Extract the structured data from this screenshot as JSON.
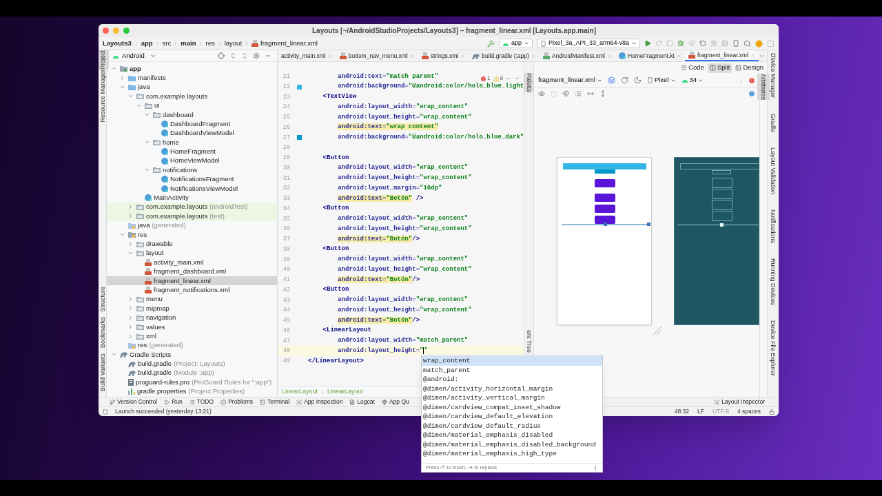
{
  "window": {
    "title": "Layouts [~/AndroidStudioProjects/Layouts3] – fragment_linear.xml [Layouts.app.main]"
  },
  "breadcrumb": [
    {
      "label": "Layouts3",
      "bold": true,
      "kind": "folder"
    },
    {
      "label": "app",
      "bold": true,
      "kind": "folder"
    },
    {
      "label": "src",
      "bold": false,
      "kind": "folder"
    },
    {
      "label": "main",
      "bold": true,
      "kind": "folder"
    },
    {
      "label": "res",
      "bold": false,
      "kind": "folder"
    },
    {
      "label": "layout",
      "bold": false,
      "kind": "folder"
    },
    {
      "label": "fragment_linear.xml",
      "bold": false,
      "kind": "xml"
    }
  ],
  "run_toolbar": {
    "module": "app",
    "device": "Pixel_3a_API_33_arm64-v8a"
  },
  "left_stripe": {
    "top": [
      {
        "label": "Project",
        "selected": true
      },
      {
        "label": "Resource Manager",
        "selected": false
      }
    ],
    "bottom": [
      {
        "label": "Structure",
        "selected": false
      },
      {
        "label": "Bookmarks",
        "selected": false
      },
      {
        "label": "Build Variants",
        "selected": false
      }
    ]
  },
  "project_panel": {
    "view": "Android",
    "tree": [
      {
        "name": "app",
        "kind": "module",
        "expanded": true,
        "selected": false,
        "children": [
          {
            "name": "manifests",
            "kind": "folder",
            "expanded": false,
            "selected": false
          },
          {
            "name": "java",
            "kind": "folder",
            "expanded": true,
            "selected": false,
            "children": [
              {
                "name": "com.example.layouts",
                "kind": "package",
                "expanded": true,
                "selected": false,
                "children": [
                  {
                    "name": "ui",
                    "kind": "package",
                    "expanded": true,
                    "selected": false,
                    "children": [
                      {
                        "name": "dashboard",
                        "kind": "package",
                        "expanded": true,
                        "selected": false,
                        "children": [
                          {
                            "name": "DashboardFragment",
                            "kind": "class",
                            "selected": false
                          },
                          {
                            "name": "DashboardViewModel",
                            "kind": "class",
                            "selected": false
                          }
                        ]
                      },
                      {
                        "name": "home",
                        "kind": "package",
                        "expanded": true,
                        "selected": false,
                        "children": [
                          {
                            "name": "HomeFragment",
                            "kind": "class",
                            "selected": false
                          },
                          {
                            "name": "HomeViewModel",
                            "kind": "class",
                            "selected": false
                          }
                        ]
                      },
                      {
                        "name": "notifications",
                        "kind": "package",
                        "expanded": true,
                        "selected": false,
                        "children": [
                          {
                            "name": "NotificationsFragment",
                            "kind": "class",
                            "selected": false
                          },
                          {
                            "name": "NotificationsViewModel",
                            "kind": "class",
                            "selected": false
                          }
                        ]
                      }
                    ]
                  },
                  {
                    "name": "MainActivity",
                    "kind": "class",
                    "selected": false
                  }
                ]
              },
              {
                "name": "com.example.layouts",
                "note": "(androidTest)",
                "kind": "test-package",
                "expanded": false,
                "selected": false
              },
              {
                "name": "com.example.layouts",
                "note": "(test)",
                "kind": "test-package",
                "expanded": false,
                "selected": false
              }
            ]
          },
          {
            "name": "java",
            "note": "(generated)",
            "kind": "generated",
            "selected": false
          },
          {
            "name": "res",
            "kind": "res",
            "expanded": true,
            "selected": false,
            "children": [
              {
                "name": "drawable",
                "kind": "package",
                "expanded": false,
                "selected": false
              },
              {
                "name": "layout",
                "kind": "package",
                "expanded": true,
                "selected": false,
                "children": [
                  {
                    "name": "activity_main.xml",
                    "kind": "xml",
                    "selected": false
                  },
                  {
                    "name": "fragment_dashboard.xml",
                    "kind": "xml",
                    "selected": false
                  },
                  {
                    "name": "fragment_linear.xml",
                    "kind": "xml",
                    "selected": true
                  },
                  {
                    "name": "fragment_notifications.xml",
                    "kind": "xml",
                    "selected": false
                  }
                ]
              },
              {
                "name": "menu",
                "kind": "package",
                "expanded": false,
                "selected": false
              },
              {
                "name": "mipmap",
                "kind": "package",
                "expanded": false,
                "selected": false
              },
              {
                "name": "navigation",
                "kind": "package",
                "expanded": false,
                "selected": false
              },
              {
                "name": "values",
                "kind": "package",
                "expanded": false,
                "selected": false
              },
              {
                "name": "xml",
                "kind": "package",
                "expanded": false,
                "selected": false
              }
            ]
          },
          {
            "name": "res",
            "note": "(generated)",
            "kind": "generated",
            "selected": false
          }
        ]
      },
      {
        "name": "Gradle Scripts",
        "kind": "gradle",
        "expanded": true,
        "selected": false,
        "children": [
          {
            "name": "build.gradle",
            "note": "(Project: Layouts)",
            "kind": "gradle",
            "selected": false
          },
          {
            "name": "build.gradle",
            "note": "(Module :app)",
            "kind": "gradle",
            "selected": false
          },
          {
            "name": "proguard-rules.pro",
            "note": "(ProGuard Rules for \":app\")",
            "kind": "file",
            "selected": false
          },
          {
            "name": "gradle.properties",
            "note": "(Project Properties)",
            "kind": "properties",
            "selected": false
          }
        ]
      }
    ]
  },
  "editor_tabs": [
    {
      "label": "activity_main.xml",
      "kind": "plain",
      "selected": false
    },
    {
      "label": "bottom_nav_menu.xml",
      "kind": "xml",
      "selected": false
    },
    {
      "label": "strings.xml",
      "kind": "xml",
      "selected": false
    },
    {
      "label": "build.gradle (:app)",
      "kind": "gradle",
      "selected": false
    },
    {
      "label": "AndroidManifest.xml",
      "kind": "manifest",
      "selected": false
    },
    {
      "label": "HomeFragment.kt",
      "kind": "class",
      "selected": false
    },
    {
      "label": "fragment_linear.xml",
      "kind": "xml",
      "selected": true
    }
  ],
  "code": {
    "errors": "1",
    "warnings": "9",
    "lines": [
      {
        "number": "21",
        "kind": "attribute",
        "warning": false,
        "current": false,
        "parts": [
          {
            "kind": "attr",
            "text": "android:text"
          },
          {
            "kind": "punct",
            "text": "="
          },
          {
            "kind": "value",
            "text": "\"match parent\""
          }
        ]
      },
      {
        "number": "22",
        "kind": "attribute",
        "warning": false,
        "current": false,
        "color": "#33b5e5",
        "parts": [
          {
            "kind": "attr",
            "text": "android:background"
          },
          {
            "kind": "punct",
            "text": "="
          },
          {
            "kind": "value",
            "text": "\"@android:color/holo_blue_light"
          }
        ]
      },
      {
        "number": "23",
        "kind": "element",
        "warning": false,
        "current": false,
        "parts": [
          {
            "kind": "tag",
            "text": "<TextView"
          }
        ]
      },
      {
        "number": "24",
        "kind": "attribute",
        "warning": false,
        "current": false,
        "parts": [
          {
            "kind": "attr",
            "text": "android:layout_width"
          },
          {
            "kind": "punct",
            "text": "="
          },
          {
            "kind": "value",
            "text": "\"wrap_content\""
          }
        ]
      },
      {
        "number": "25",
        "kind": "attribute",
        "warning": false,
        "current": false,
        "parts": [
          {
            "kind": "attr",
            "text": "android:layout_height"
          },
          {
            "kind": "punct",
            "text": "="
          },
          {
            "kind": "value",
            "text": "\"wrap_content\""
          }
        ]
      },
      {
        "number": "26",
        "kind": "attribute",
        "warning": true,
        "current": false,
        "parts": [
          {
            "kind": "attr",
            "text": "android:text"
          },
          {
            "kind": "punct",
            "text": "="
          },
          {
            "kind": "value",
            "text": "\"wrap content\""
          }
        ]
      },
      {
        "number": "27",
        "kind": "attribute",
        "warning": false,
        "current": false,
        "color": "#0099cc",
        "parts": [
          {
            "kind": "attr",
            "text": "android:background"
          },
          {
            "kind": "punct",
            "text": "="
          },
          {
            "kind": "value",
            "text": "\"@android:color/holo_blue_dark\""
          }
        ]
      },
      {
        "number": "28",
        "kind": "blank"
      },
      {
        "number": "29",
        "kind": "element",
        "warning": false,
        "current": false,
        "parts": [
          {
            "kind": "tag",
            "text": "<Button"
          }
        ]
      },
      {
        "number": "30",
        "kind": "attribute",
        "warning": false,
        "current": false,
        "parts": [
          {
            "kind": "attr",
            "text": "android:layout_width"
          },
          {
            "kind": "punct",
            "text": "="
          },
          {
            "kind": "value",
            "text": "\"wrap_content\""
          }
        ]
      },
      {
        "number": "31",
        "kind": "attribute",
        "warning": false,
        "current": false,
        "parts": [
          {
            "kind": "attr",
            "text": "android:layout_height"
          },
          {
            "kind": "punct",
            "text": "="
          },
          {
            "kind": "value",
            "text": "\"wrap_content\""
          }
        ]
      },
      {
        "number": "32",
        "kind": "attribute",
        "warning": false,
        "current": false,
        "parts": [
          {
            "kind": "attr",
            "text": "android:layout_margin"
          },
          {
            "kind": "punct",
            "text": "="
          },
          {
            "kind": "value",
            "text": "\"16dp\""
          }
        ]
      },
      {
        "number": "33",
        "kind": "attribute",
        "warning": true,
        "current": false,
        "parts": [
          {
            "kind": "attr",
            "text": "android:text"
          },
          {
            "kind": "punct",
            "text": "="
          },
          {
            "kind": "value",
            "text": "\"Botón\""
          },
          {
            "kind": "tag",
            "text": " />"
          }
        ]
      },
      {
        "number": "34",
        "kind": "element",
        "warning": false,
        "current": false,
        "parts": [
          {
            "kind": "tag",
            "text": "<Button"
          }
        ]
      },
      {
        "number": "35",
        "kind": "attribute",
        "warning": false,
        "current": false,
        "parts": [
          {
            "kind": "attr",
            "text": "android:layout_width"
          },
          {
            "kind": "punct",
            "text": "="
          },
          {
            "kind": "value",
            "text": "\"wrap_content\""
          }
        ]
      },
      {
        "number": "36",
        "kind": "attribute",
        "warning": false,
        "current": false,
        "parts": [
          {
            "kind": "attr",
            "text": "android:layout_height"
          },
          {
            "kind": "punct",
            "text": "="
          },
          {
            "kind": "value",
            "text": "\"wrap_content\""
          }
        ]
      },
      {
        "number": "37",
        "kind": "attribute",
        "warning": true,
        "current": false,
        "parts": [
          {
            "kind": "attr",
            "text": "android:text"
          },
          {
            "kind": "punct",
            "text": "="
          },
          {
            "kind": "value",
            "text": "\"Botón\""
          },
          {
            "kind": "tag",
            "text": "/>"
          }
        ]
      },
      {
        "number": "38",
        "kind": "element",
        "warning": false,
        "current": false,
        "parts": [
          {
            "kind": "tag",
            "text": "<Button"
          }
        ]
      },
      {
        "number": "39",
        "kind": "attribute",
        "warning": false,
        "current": false,
        "parts": [
          {
            "kind": "attr",
            "text": "android:layout_width"
          },
          {
            "kind": "punct",
            "text": "="
          },
          {
            "kind": "value",
            "text": "\"wrap_content\""
          }
        ]
      },
      {
        "number": "40",
        "kind": "attribute",
        "warning": false,
        "current": false,
        "parts": [
          {
            "kind": "attr",
            "text": "android:layout_height"
          },
          {
            "kind": "punct",
            "text": "="
          },
          {
            "kind": "value",
            "text": "\"wrap_content\""
          }
        ]
      },
      {
        "number": "41",
        "kind": "attribute",
        "warning": true,
        "current": false,
        "parts": [
          {
            "kind": "attr",
            "text": "android:text"
          },
          {
            "kind": "punct",
            "text": "="
          },
          {
            "kind": "value",
            "text": "\"Botón\""
          },
          {
            "kind": "tag",
            "text": "/>"
          }
        ]
      },
      {
        "number": "42",
        "kind": "element",
        "warning": false,
        "current": false,
        "parts": [
          {
            "kind": "tag",
            "text": "<Button"
          }
        ]
      },
      {
        "number": "43",
        "kind": "attribute",
        "warning": false,
        "current": false,
        "parts": [
          {
            "kind": "attr",
            "text": "android:layout_width"
          },
          {
            "kind": "punct",
            "text": "="
          },
          {
            "kind": "value",
            "text": "\"wrap_content\""
          }
        ]
      },
      {
        "number": "44",
        "kind": "attribute",
        "warning": false,
        "current": false,
        "parts": [
          {
            "kind": "attr",
            "text": "android:layout_height"
          },
          {
            "kind": "punct",
            "text": "="
          },
          {
            "kind": "value",
            "text": "\"wrap_content\""
          }
        ]
      },
      {
        "number": "45",
        "kind": "attribute",
        "warning": true,
        "current": false,
        "parts": [
          {
            "kind": "attr",
            "text": "android:text"
          },
          {
            "kind": "punct",
            "text": "="
          },
          {
            "kind": "value",
            "text": "\"Botón\""
          },
          {
            "kind": "tag",
            "text": "/>"
          }
        ]
      },
      {
        "number": "46",
        "kind": "element",
        "warning": false,
        "current": false,
        "parts": [
          {
            "kind": "tag",
            "text": "<LinearLayout"
          }
        ]
      },
      {
        "number": "47",
        "kind": "attribute",
        "warning": false,
        "current": false,
        "parts": [
          {
            "kind": "attr",
            "text": "android:layout_width"
          },
          {
            "kind": "punct",
            "text": "="
          },
          {
            "kind": "value",
            "text": "\"match_parent\""
          }
        ]
      },
      {
        "number": "48",
        "kind": "attribute",
        "warning": false,
        "current": true,
        "parts": [
          {
            "kind": "attr",
            "text": "android:layout_height"
          },
          {
            "kind": "punct",
            "text": "="
          },
          {
            "kind": "value",
            "text": "\""
          },
          {
            "kind": "caret"
          },
          {
            "kind": "value",
            "text": "\""
          }
        ]
      },
      {
        "number": "49",
        "kind": "root",
        "warning": false,
        "current": false,
        "parts": [
          {
            "kind": "tag",
            "text": "</LinearLayout>"
          }
        ]
      }
    ]
  },
  "code_breadcrumb": [
    "LinearLayout",
    "LinearLayout"
  ],
  "editor_stripe": {
    "top": {
      "label": "Palette",
      "selected": true
    },
    "bottom": {
      "label": "ent Tree",
      "selected": false
    }
  },
  "design": {
    "view_modes": [
      {
        "label": "Code",
        "kind": "code",
        "selected": false
      },
      {
        "label": "Split",
        "kind": "split",
        "selected": true
      },
      {
        "label": "Design",
        "kind": "design",
        "selected": false
      }
    ],
    "file": "fragment_linear.xml",
    "device": "Pixel",
    "api": "34"
  },
  "attributes_stripe": {
    "label": "Attributes",
    "selected": true
  },
  "right_stripe": [
    "Device Manager",
    "Gradle",
    "Layout Validation",
    "Notifications",
    "Running Devices",
    "Device File Explorer"
  ],
  "tool_windows": [
    {
      "label": "Version Control",
      "kind": "vcs"
    },
    {
      "label": "Run",
      "kind": "run"
    },
    {
      "label": "TODO",
      "kind": "todo"
    },
    {
      "label": "Problems",
      "kind": "problems"
    },
    {
      "label": "Terminal",
      "kind": "terminal"
    },
    {
      "label": "App Inspection",
      "kind": "inspection"
    },
    {
      "label": "Logcat",
      "kind": "logcat"
    },
    {
      "label": "App Qu",
      "kind": "quality"
    }
  ],
  "layout_inspector": "Layout Inspector",
  "status": {
    "message": "Launch succeeded (yesterday 13:21)",
    "position": "48:32",
    "line_separator": "LF",
    "encoding": "UTF-8",
    "indent": "4 spaces"
  },
  "completion": {
    "items": [
      {
        "text": "wrap_content",
        "selected": true
      },
      {
        "text": "match_parent",
        "selected": false
      },
      {
        "text": "@android:",
        "selected": false
      },
      {
        "text": "@dimen/activity_horizontal_margin",
        "selected": false
      },
      {
        "text": "@dimen/activity_vertical_margin",
        "selected": false
      },
      {
        "text": "@dimen/cardview_compat_inset_shadow",
        "selected": false
      },
      {
        "text": "@dimen/cardview_default_elevation",
        "selected": false
      },
      {
        "text": "@dimen/cardview_default_radius",
        "selected": false
      },
      {
        "text": "@dimen/material_emphasis_disabled",
        "selected": false
      },
      {
        "text": "@dimen/material_emphasis_disabled_background",
        "selected": false
      },
      {
        "text": "@dimen/material_emphasis_high_type",
        "selected": false
      }
    ],
    "hint": "Press ⏎ to insert, ⇥ to replace"
  }
}
